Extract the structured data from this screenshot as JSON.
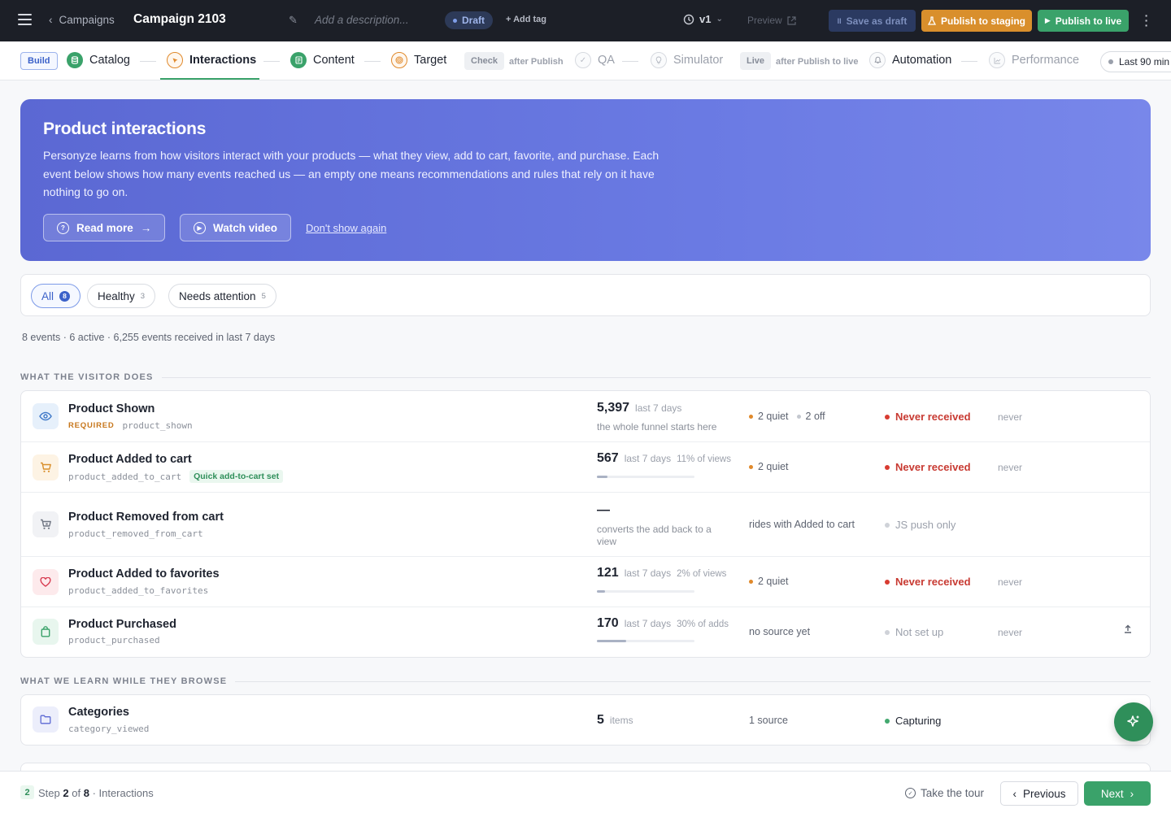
{
  "topbar": {
    "back_label": "Campaigns",
    "title": "Campaign 2103",
    "description_placeholder": "Add a description...",
    "status": "Draft",
    "add_tag": "+ Add tag",
    "version": "v1",
    "preview": "Preview",
    "save_draft": "Save as draft",
    "publish_staging": "Publish to staging",
    "publish_live": "Publish to live"
  },
  "steps": {
    "build_label": "Build",
    "check_label": "Check",
    "live_label": "Live",
    "check_note": "after Publish",
    "live_note": "after Publish to live",
    "items": [
      {
        "label": "Catalog"
      },
      {
        "label": "Interactions"
      },
      {
        "label": "Content"
      },
      {
        "label": "Target"
      },
      {
        "label": "QA"
      },
      {
        "label": "Simulator"
      },
      {
        "label": "Automation"
      },
      {
        "label": "Performance"
      }
    ],
    "range": "Last 90 min"
  },
  "hero": {
    "title": "Product interactions",
    "body": "Personyze learns from how visitors interact with your products — what they view, add to cart, favorite, and purchase. Each event below shows how many events reached us — an empty one means recommendations and rules that rely on it have nothing to go on.",
    "read_more": "Read more",
    "watch_video": "Watch video",
    "dismiss": "Don't show again"
  },
  "filters": [
    {
      "label": "All",
      "count": "8"
    },
    {
      "label": "Healthy",
      "count": "3"
    },
    {
      "label": "Needs attention",
      "count": "5"
    }
  ],
  "summary": "8 events · 6 active · 6,255 events received in last 7 days",
  "sections": {
    "visitor": "WHAT THE VISITOR DOES",
    "browse": "WHAT WE LEARN WHILE THEY BROWSE"
  },
  "events": [
    {
      "name": "Product Shown",
      "badge": "REQUIRED",
      "code": "product_shown",
      "count": "5,397",
      "unit": "last 7 days",
      "note": "the whole funnel starts here",
      "src_a": "2 quiet",
      "src_b": "2 off",
      "status": "Never received",
      "last": "never"
    },
    {
      "name": "Product Added to cart",
      "code": "product_added_to_cart",
      "tag": "Quick add-to-cart set",
      "count": "567",
      "unit": "last 7 days",
      "pct": "11% of views",
      "fill": 0.11,
      "src_a": "2 quiet",
      "status": "Never received",
      "last": "never"
    },
    {
      "name": "Product Removed from cart",
      "code": "product_removed_from_cart",
      "count": "—",
      "note": "converts the add back to a view",
      "src_text": "rides with Added to cart",
      "status": "JS push only"
    },
    {
      "name": "Product Added to favorites",
      "code": "product_added_to_favorites",
      "count": "121",
      "unit": "last 7 days",
      "pct": "2% of views",
      "fill": 0.02,
      "src_a": "2 quiet",
      "status": "Never received",
      "last": "never"
    },
    {
      "name": "Product Purchased",
      "code": "product_purchased",
      "count": "170",
      "unit": "last 7 days",
      "pct": "30% of adds",
      "fill": 0.3,
      "src_text": "no source yet",
      "status": "Not set up",
      "last": "never"
    }
  ],
  "browse_events": [
    {
      "name": "Categories",
      "code": "category_viewed",
      "count": "5",
      "unit": "items",
      "src_text": "1 source",
      "status": "Capturing"
    }
  ],
  "footer": {
    "step_number": "2",
    "step_prefix": "Step",
    "step_current": "2",
    "step_of": "of",
    "step_total": "8",
    "step_name": "· Interactions",
    "tour": "Take the tour",
    "previous": "Previous",
    "next": "Next"
  },
  "colors": {
    "brand_green": "#3aa26a",
    "staging_orange": "#d98f2c",
    "hero_blue": "#5b68d3",
    "alert_red": "#c83a32"
  },
  "icons": {
    "product_shown": "eye-icon",
    "added_to_cart": "cart-icon",
    "removed_from_cart": "cart-remove-icon",
    "favorites": "heart-icon",
    "purchased": "bag-icon",
    "categories": "folder-icon",
    "fab": "sparkle-icon"
  }
}
